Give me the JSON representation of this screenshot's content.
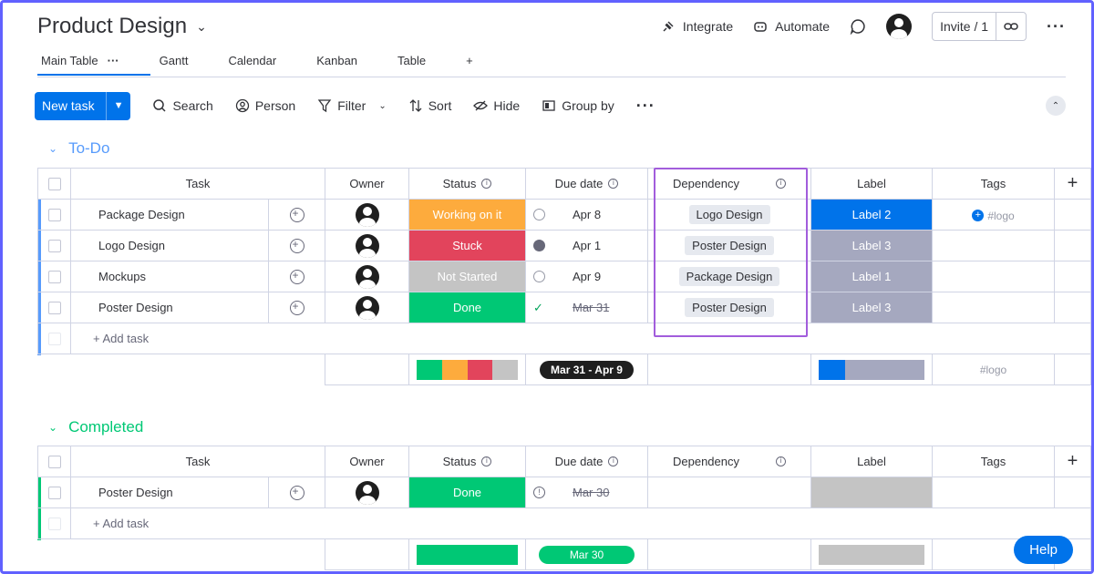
{
  "header": {
    "title": "Product Design",
    "integrate": "Integrate",
    "automate": "Automate",
    "invite": "Invite / 1"
  },
  "tabs": [
    "Main Table",
    "Gantt",
    "Calendar",
    "Kanban",
    "Table",
    "+"
  ],
  "toolbar": {
    "new_task": "New task",
    "search": "Search",
    "person": "Person",
    "filter": "Filter",
    "sort": "Sort",
    "hide": "Hide",
    "group_by": "Group by"
  },
  "columns": [
    "Task",
    "Owner",
    "Status",
    "Due date",
    "Dependency",
    "Label",
    "Tags"
  ],
  "add_task": "+ Add task",
  "colors": {
    "working": "#fdab3d",
    "stuck": "#e2445c",
    "not_started": "#c4c4c4",
    "done": "#00c875",
    "label2": "#0073ea",
    "label_gray": "#a5a8bf",
    "todo_group": "#579bfc",
    "completed_group": "#00c875"
  },
  "groups": [
    {
      "title": "To-Do",
      "rows": [
        {
          "task": "Package Design",
          "status": "Working on it",
          "due": "Apr 8",
          "dependency": "Logo Design",
          "label": "Label 2",
          "tag": "#logo"
        },
        {
          "task": "Logo Design",
          "status": "Stuck",
          "due": "Apr 1",
          "dependency": "Poster Design",
          "label": "Label 3",
          "tag": ""
        },
        {
          "task": "Mockups",
          "status": "Not Started",
          "due": "Apr 9",
          "dependency": "Package Design",
          "label": "Label 1",
          "tag": ""
        },
        {
          "task": "Poster Design",
          "status": "Done",
          "due": "Mar 31",
          "dependency": "Poster Design",
          "label": "Label 3",
          "tag": ""
        }
      ],
      "summary": {
        "date_range": "Mar 31 - Apr 9",
        "tag": "#logo"
      }
    },
    {
      "title": "Completed",
      "rows": [
        {
          "task": "Poster Design",
          "status": "Done",
          "due": "Mar 30",
          "dependency": "",
          "label": "",
          "tag": ""
        }
      ],
      "summary": {
        "date_range": "Mar 30",
        "tag": ""
      }
    }
  ],
  "help": "Help"
}
